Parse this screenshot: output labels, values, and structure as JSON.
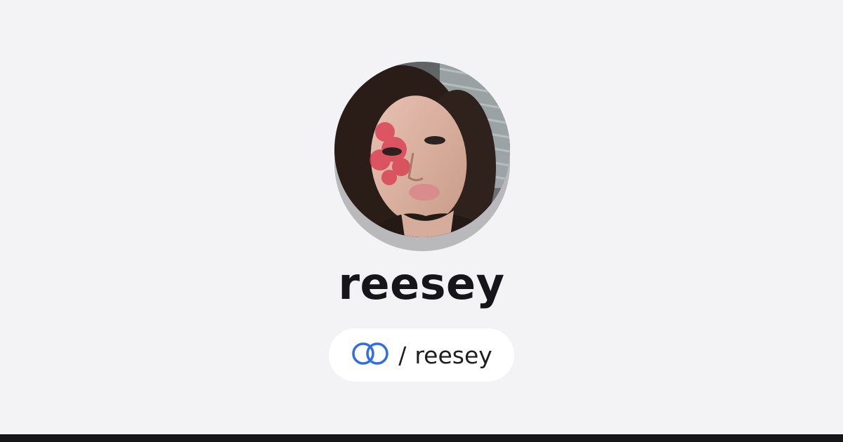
{
  "profile": {
    "name": "reesey",
    "avatar_alt": "Profile photo"
  },
  "handle": {
    "separator": "/",
    "username": "reesey",
    "logo_icon": "linked-rings-icon",
    "accent_color": "#2f6fe4"
  },
  "theme": {
    "background": "#f3f3f6",
    "footer_color": "#16161a"
  }
}
